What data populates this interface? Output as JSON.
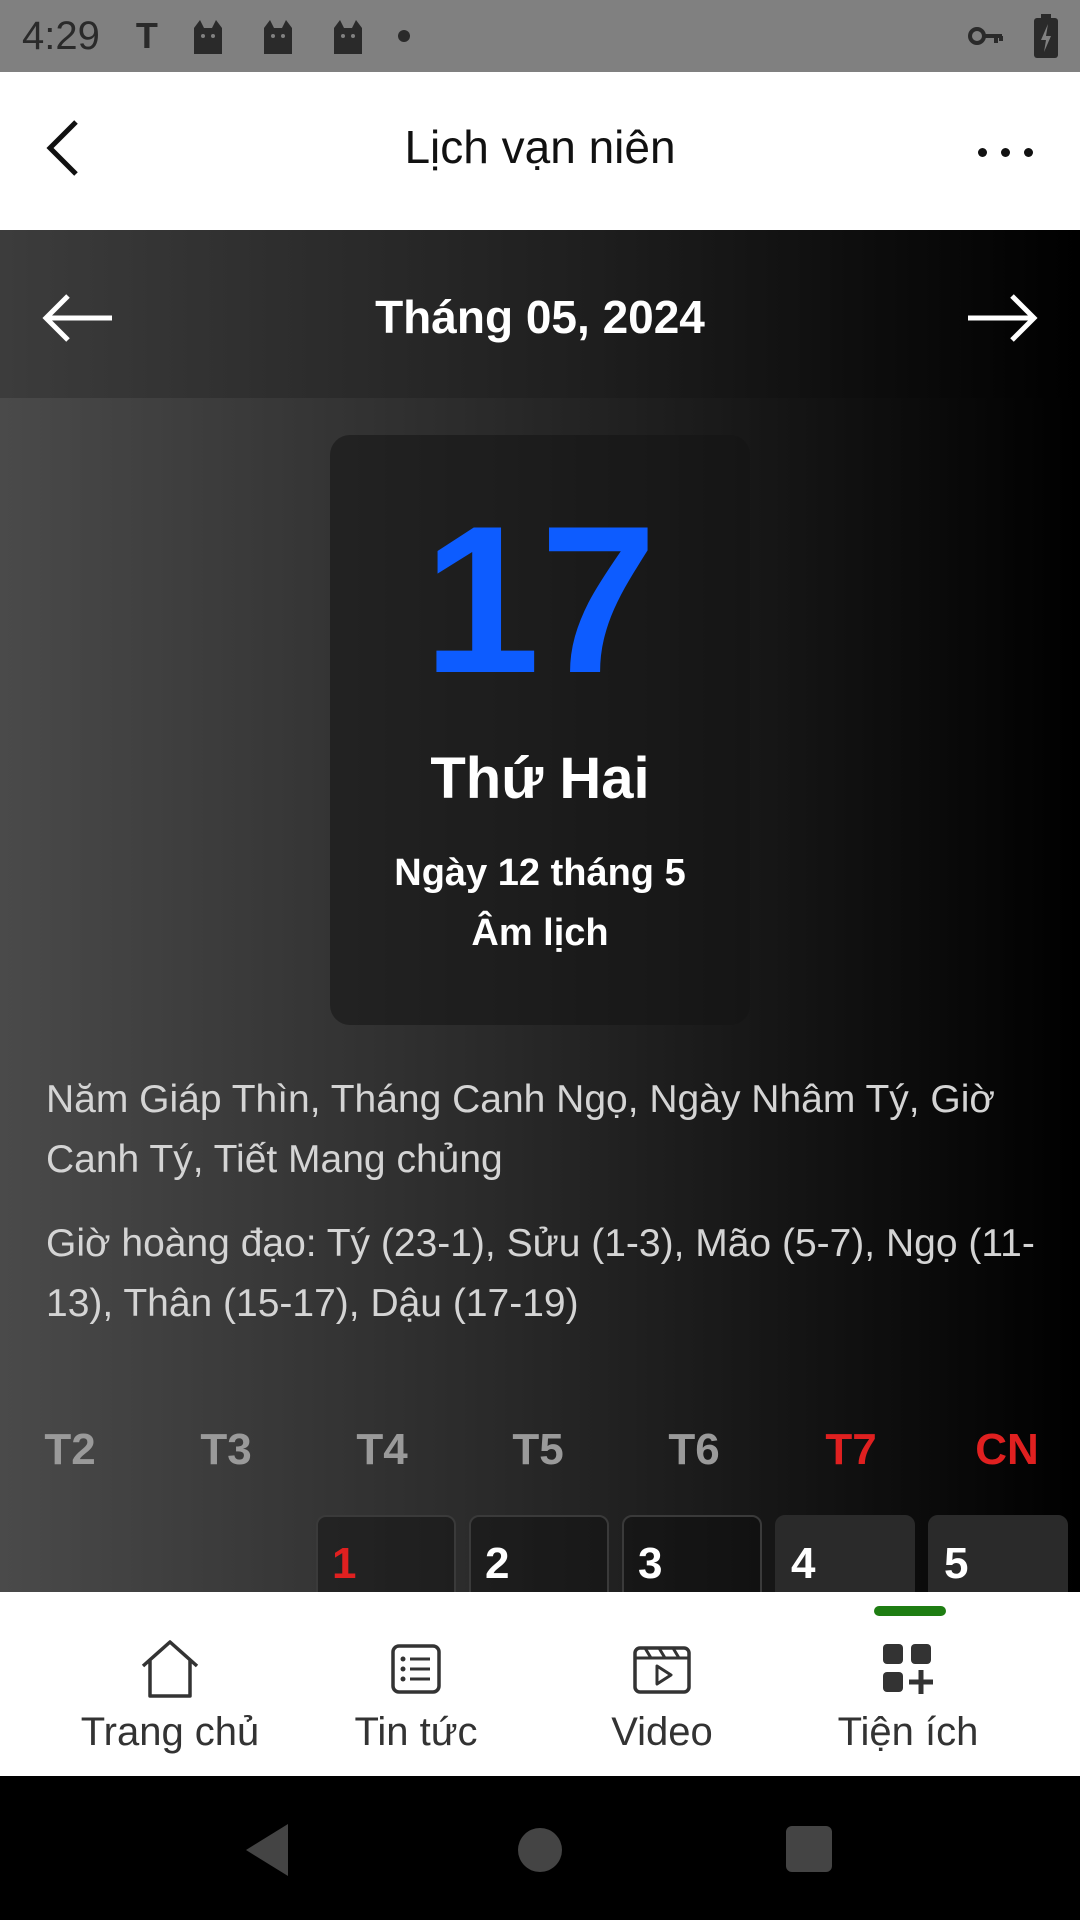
{
  "status_bar": {
    "time": "4:29",
    "notification_letter": "T",
    "icons": [
      "cat-icon",
      "cat-icon",
      "cat-icon",
      "dot-icon",
      "key-icon",
      "battery-charging-icon"
    ]
  },
  "header": {
    "title": "Lịch vạn niên"
  },
  "calendar": {
    "month_title": "Tháng 05, 2024",
    "day_number": "17",
    "weekday": "Thứ Hai",
    "lunar_line1": "Ngày 12 tháng 5",
    "lunar_line2": "Âm lịch",
    "can_chi": "Năm Giáp Thìn, Tháng Canh Ngọ, Ngày Nhâm Tý, Giờ Canh Tý, Tiết Mang chủng",
    "gio_hoang_dao": "Giờ hoàng đạo: Tý (23-1), Sửu (1-3), Mão (5-7), Ngọ (11-13), Thân (15-17), Dậu (17-19)",
    "weekday_headers": [
      "T2",
      "T3",
      "T4",
      "T5",
      "T6",
      "T7",
      "CN"
    ],
    "visible_days": [
      "1",
      "2",
      "3",
      "4",
      "5"
    ],
    "colors": {
      "day_number": "#0d5cff",
      "weekend": "#e02020"
    }
  },
  "bottom_nav": {
    "items": [
      {
        "label": "Trang chủ",
        "icon": "home-icon"
      },
      {
        "label": "Tin tức",
        "icon": "news-list-icon"
      },
      {
        "label": "Video",
        "icon": "video-icon"
      },
      {
        "label": "Tiện ích",
        "icon": "utilities-grid-icon"
      }
    ],
    "active_index": 3,
    "active_color": "#1e7d12"
  }
}
